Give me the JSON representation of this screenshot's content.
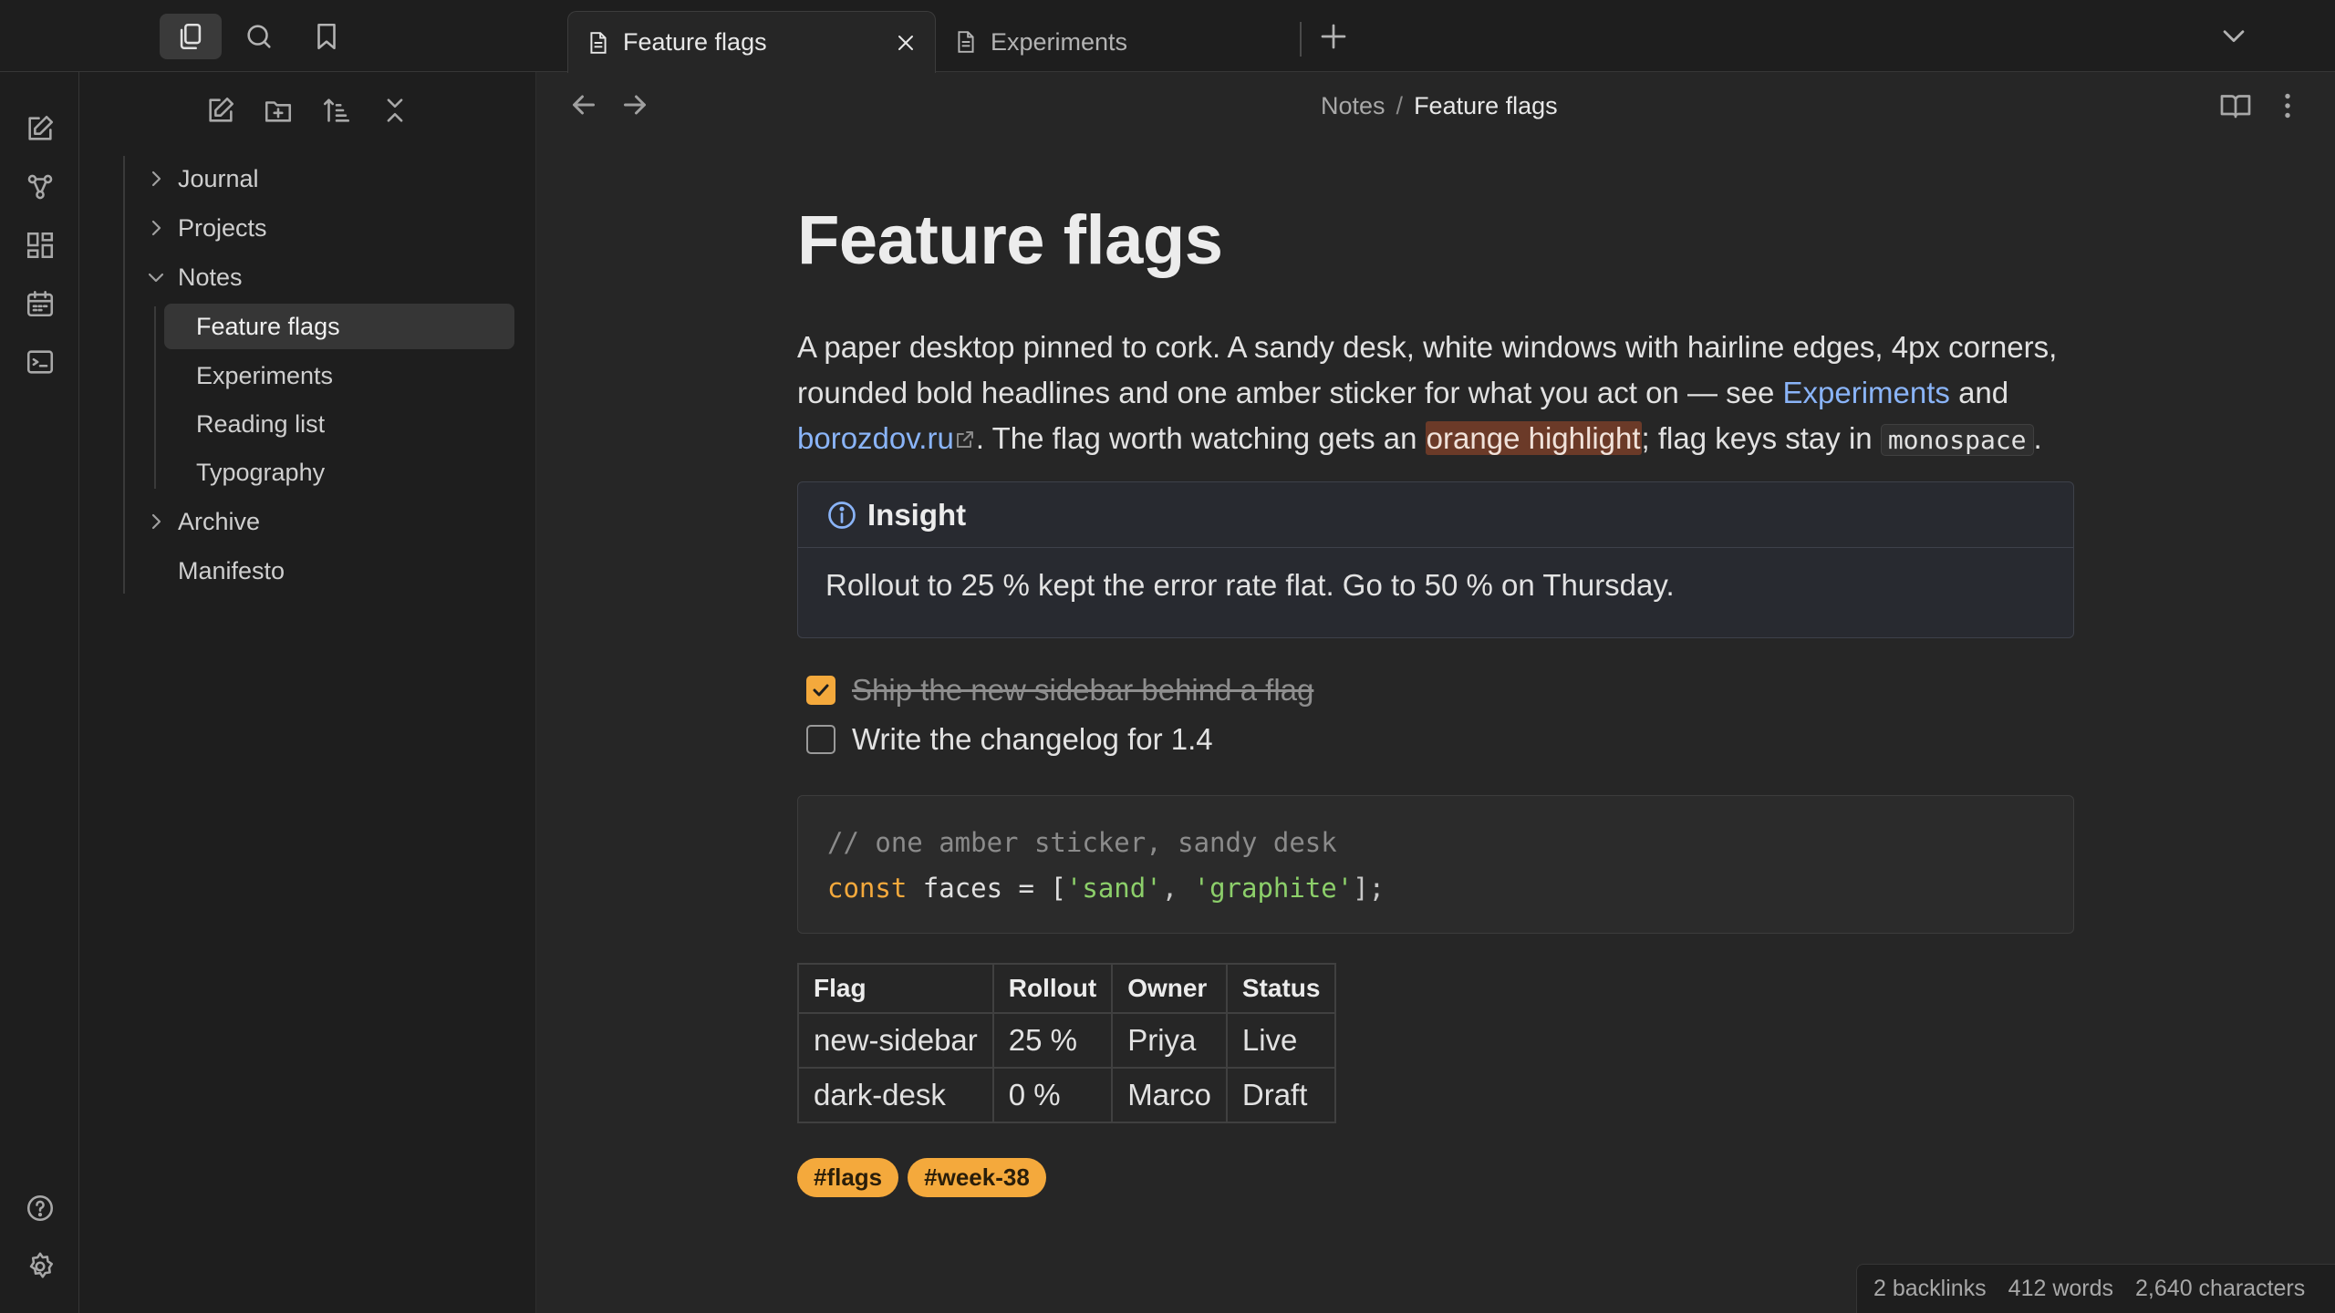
{
  "tabs": [
    {
      "label": "Feature flags",
      "active": true
    },
    {
      "label": "Experiments",
      "active": false
    }
  ],
  "sidebar": {
    "tree": [
      {
        "label": "Journal",
        "type": "folder",
        "expanded": false
      },
      {
        "label": "Projects",
        "type": "folder",
        "expanded": false
      },
      {
        "label": "Notes",
        "type": "folder",
        "expanded": true
      },
      {
        "label": "Feature flags",
        "type": "file",
        "active": true
      },
      {
        "label": "Experiments",
        "type": "file"
      },
      {
        "label": "Reading list",
        "type": "file"
      },
      {
        "label": "Typography",
        "type": "file"
      },
      {
        "label": "Archive",
        "type": "folder",
        "expanded": false
      },
      {
        "label": "Manifesto",
        "type": "file"
      }
    ]
  },
  "breadcrumb": {
    "parent": "Notes",
    "separator": "/",
    "current": "Feature flags"
  },
  "note": {
    "title": "Feature flags",
    "para": {
      "t1": "A paper desktop pinned to cork. A sandy desk, white windows with hairline edges, 4px corners, rounded bold headlines and one amber sticker for what you act on — see ",
      "link1": "Experiments",
      "t2": " and ",
      "link2": "borozdov.ru",
      "t3": ". The flag worth watching gets an ",
      "highlight": "orange highlight",
      "t4": "; flag keys stay in ",
      "code": "monospace",
      "t5": "."
    },
    "callout": {
      "title": "Insight",
      "body": "Rollout to 25 % kept the error rate flat. Go to 50 % on Thursday."
    },
    "tasks": [
      {
        "text": "Ship the new sidebar behind a flag",
        "done": true
      },
      {
        "text": "Write the changelog for 1.4",
        "done": false
      }
    ],
    "code": {
      "comment": "// one amber sticker, sandy desk",
      "kw": "const",
      "ident": " faces = [",
      "s1": "'sand'",
      "comma": ", ",
      "s2": "'graphite'",
      "end": "];"
    },
    "table": {
      "headers": [
        "Flag",
        "Rollout",
        "Owner",
        "Status"
      ],
      "rows": [
        [
          "new-sidebar",
          "25 %",
          "Priya",
          "Live"
        ],
        [
          "dark-desk",
          "0 %",
          "Marco",
          "Draft"
        ]
      ]
    },
    "tags": [
      "#flags",
      "#week-38"
    ]
  },
  "statusbar": {
    "backlinks": "2 backlinks",
    "words": "412 words",
    "characters": "2,640 characters"
  },
  "colors": {
    "accent": "#f4a93c",
    "link": "#8ab4f8",
    "highlight": "#6b3a28"
  }
}
